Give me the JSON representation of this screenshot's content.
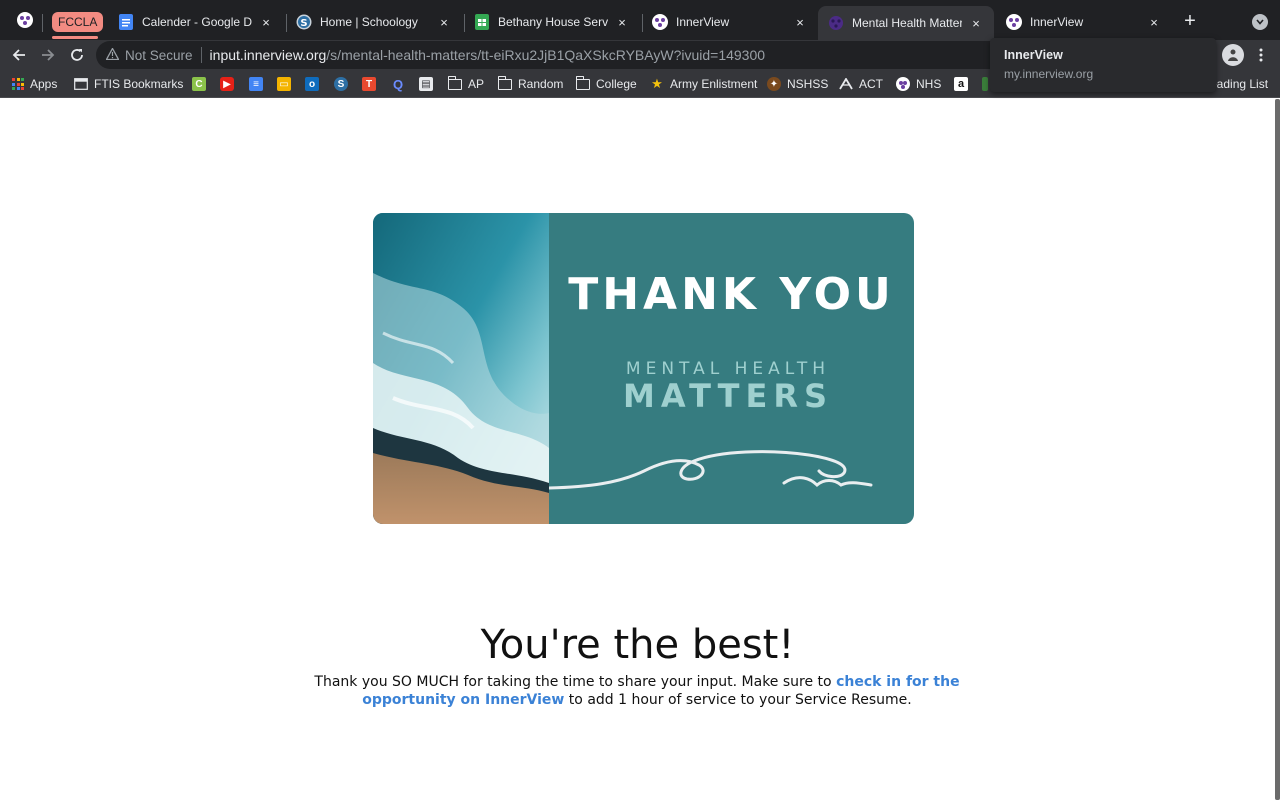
{
  "browser": {
    "group_label": "FCCLA",
    "tabs": [
      {
        "title": "Calender - Google Docs",
        "favicon": "google-docs-icon"
      },
      {
        "title": "Home | Schoology",
        "favicon": "schoology-icon"
      },
      {
        "title": "Bethany House Services",
        "favicon": "google-sheets-icon"
      },
      {
        "title": "InnerView",
        "favicon": "innerview-icon"
      },
      {
        "title": "Mental Health Matters",
        "favicon": "innerview-icon",
        "active": true
      },
      {
        "title": "InnerView",
        "favicon": "innerview-icon"
      }
    ],
    "close_glyph": "×",
    "new_tab_glyph": "+",
    "security_label": "Not Secure",
    "url_host": "input.innerview.org",
    "url_path": "/s/mental-health-matters/tt-eiRxu2JjB1QaXSkcRYBAyW?ivuid=149300",
    "tooltip": {
      "title": "InnerView",
      "url": "my.innerview.org"
    }
  },
  "bookmarks": [
    {
      "label": "Apps",
      "icon": "apps-grid-icon"
    },
    {
      "label": "FTIS Bookmarks",
      "icon": "bookmarks-icon"
    },
    {
      "label": "",
      "icon": "c-icon"
    },
    {
      "label": "",
      "icon": "youtube-icon"
    },
    {
      "label": "",
      "icon": "docs-icon"
    },
    {
      "label": "",
      "icon": "slides-icon"
    },
    {
      "label": "",
      "icon": "outlook-icon"
    },
    {
      "label": "",
      "icon": "schoology-icon"
    },
    {
      "label": "",
      "icon": "t-icon"
    },
    {
      "label": "",
      "icon": "q-icon"
    },
    {
      "label": "",
      "icon": "doc-icon"
    },
    {
      "label": "AP",
      "icon": "folder-icon"
    },
    {
      "label": "Random",
      "icon": "folder-icon"
    },
    {
      "label": "College",
      "icon": "folder-icon"
    },
    {
      "label": "Army Enlistment",
      "icon": "star-icon"
    },
    {
      "label": "NSHSS",
      "icon": "nshss-icon"
    },
    {
      "label": "ACT",
      "icon": "act-icon"
    },
    {
      "label": "NHS",
      "icon": "innerview-icon"
    },
    {
      "label": "",
      "icon": "amazon-icon"
    },
    {
      "label": "eading List",
      "icon": "reading-list-icon"
    }
  ],
  "card": {
    "thank_you": "THANK YOU",
    "line1": "MENTAL   HEALTH",
    "line2": "MATTERS"
  },
  "page": {
    "heading": "You're the best!",
    "message_before": "Thank you SO MUCH for taking the time to share your input. Make sure to ",
    "message_link": "check in for the opportunity on InnerView",
    "message_after": " to add 1 hour of service to your Service Resume."
  },
  "colors": {
    "card_teal": "#367c80",
    "link_blue": "#3b82d6",
    "group_chip": "#f28b82"
  }
}
